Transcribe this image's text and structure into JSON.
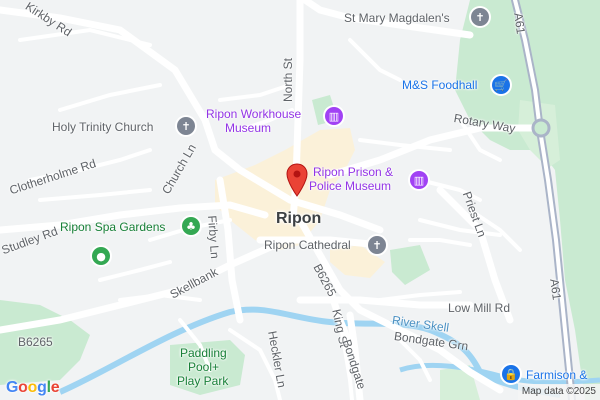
{
  "city_label": "Ripon",
  "roads": {
    "kirkby_rd": "Kirkby Rd",
    "north_st": "North St",
    "clotherholme_rd": "Clotherholme Rd",
    "church_ln": "Church Ln",
    "studley_rd": "Studley Rd",
    "firby_ln": "Firby Ln",
    "skellbank": "Skellbank",
    "b6265_west": "B6265",
    "b6265_south": "B6265",
    "king_st": "King St",
    "bondgate": "Bondgate",
    "bondgate_grn": "Bondgate Grn",
    "heckler_ln": "Heckler Ln",
    "rotary_way": "Rotary Way",
    "priest_ln": "Priest Ln",
    "low_mill_rd": "Low Mill Rd",
    "a61_north": "A61",
    "a61_south": "A61"
  },
  "water": {
    "river_skell": "River Skell"
  },
  "pois": {
    "st_mary": {
      "label": "St Mary Magdalen's",
      "icon": "cross-icon"
    },
    "ms_foodhall": {
      "label": "M&S Foodhall",
      "icon": "shopping-cart-icon"
    },
    "workhouse_line1": "Ripon Workhouse",
    "workhouse_line2": "Museum",
    "holy_trinity": {
      "label": "Holy Trinity Church",
      "icon": "cross-icon"
    },
    "prison_line1": "Ripon Prison &",
    "prison_line2": "Police Museum",
    "spa_gardens": {
      "label": "Ripon Spa Gardens",
      "icon": "tree-icon"
    },
    "cathedral": {
      "label": "Ripon Cathedral",
      "icon": "cross-icon"
    },
    "paddling_line1": "Paddling",
    "paddling_line2": "Pool+",
    "paddling_line3": "Play Park",
    "farmison": {
      "label": "Farmison &",
      "icon": "lock-icon"
    }
  },
  "branding": {
    "google_logo": "Google",
    "attribution": "Map data ©2025"
  },
  "colors": {
    "background": "#f1f3f4",
    "road": "#ffffff",
    "major_road": "#aab4c8",
    "green": "#c9ead1",
    "water": "#9fd4f2",
    "poi_museum": "#a142f4",
    "poi_generic": "#7d8593",
    "poi_park": "#34a853",
    "poi_shop": "#1a73e8",
    "marker": "#ea4335"
  }
}
